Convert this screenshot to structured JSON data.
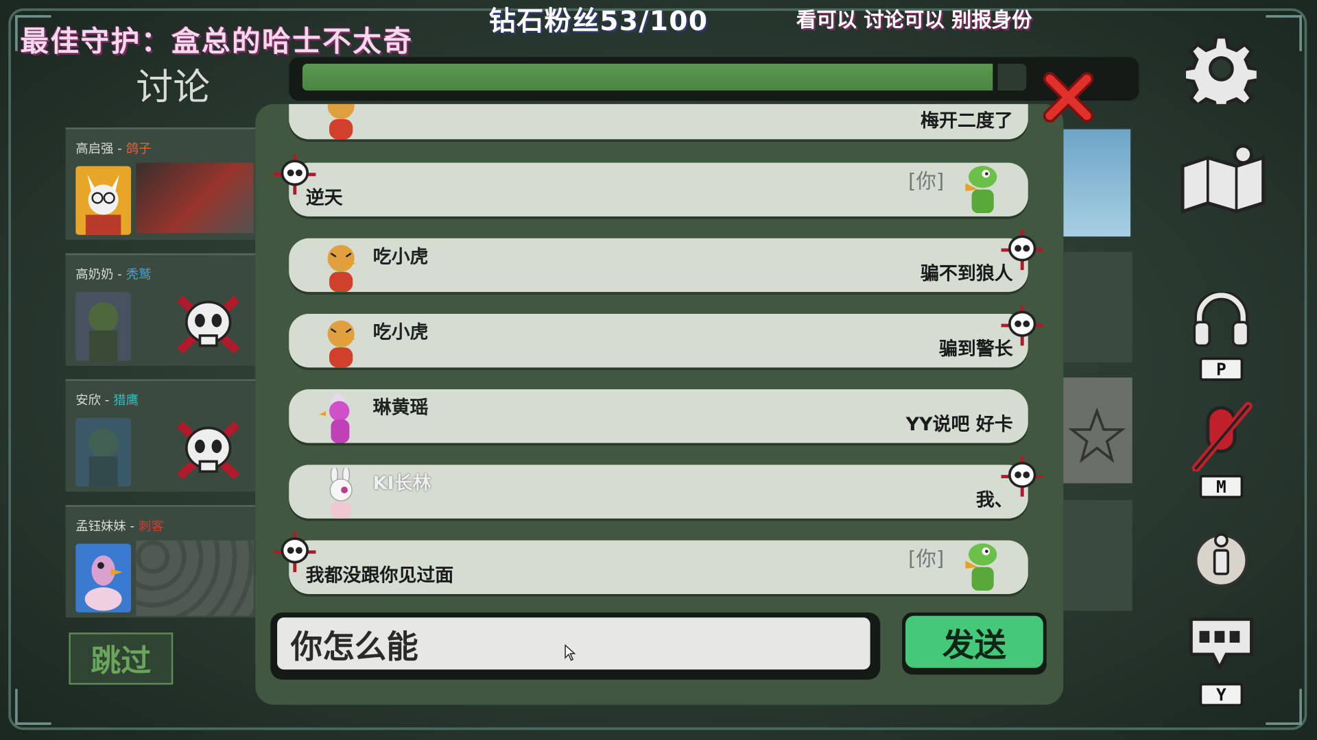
{
  "overlay": {
    "guardian": "最佳守护：盒总的哈士不太奇",
    "fans": "钻石粉丝53/100",
    "rules": "看可以 讨论可以 别报身份"
  },
  "discussion": {
    "title": "讨论",
    "timer_remaining_fraction": 0.96,
    "skip_label": "跳过"
  },
  "players": [
    {
      "name": "高启强",
      "role": "鸽子",
      "role_color": "#e0663a",
      "status": "alive"
    },
    {
      "name": "高奶奶",
      "role": "秃鹫",
      "role_color": "#3fa6d6",
      "status": "dead"
    },
    {
      "name": "安欣",
      "role": "猎鹰",
      "role_color": "#2fc0c0",
      "status": "dead"
    },
    {
      "name": "孟钰妹妹",
      "role": "刺客",
      "role_color": "#d43a3a",
      "status": "alive"
    }
  ],
  "messages": [
    {
      "sender": "",
      "text": "梅开二度了",
      "mine": false,
      "dead": false
    },
    {
      "sender": "[你]",
      "text": "逆天",
      "mine": true,
      "dead": true
    },
    {
      "sender": "吃小虎",
      "text": "骗不到狼人",
      "mine": false,
      "dead": true
    },
    {
      "sender": "吃小虎",
      "text": "骗到警长",
      "mine": false,
      "dead": true
    },
    {
      "sender": "琳黄瑶",
      "text": "YY说吧 好卡",
      "mine": false,
      "dead": false
    },
    {
      "sender": "KI长林",
      "text": "我、",
      "mine": false,
      "dead": true
    },
    {
      "sender": "[你]",
      "text": "我都没跟你见过面",
      "mine": true,
      "dead": true
    }
  ],
  "composer": {
    "input_value": "你怎么能",
    "send_label": "发送"
  },
  "side_keys": {
    "voice": "P",
    "mute": "M",
    "chat": "Y"
  }
}
